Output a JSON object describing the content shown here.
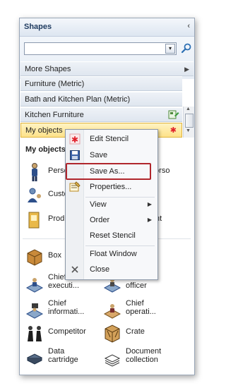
{
  "pane": {
    "title": "Shapes",
    "collapse_glyph": "‹",
    "search_dropdown_glyph": "▾",
    "search_value": "",
    "search_icon": "search-icon"
  },
  "stencils": [
    {
      "label": "More Shapes",
      "has_arrow": true
    },
    {
      "label": "Furniture (Metric)"
    },
    {
      "label": "Bath and Kitchen Plan (Metric)"
    },
    {
      "label": "Kitchen  Furniture"
    },
    {
      "label": "My objects",
      "active": true,
      "marker": "✱"
    }
  ],
  "arrow_glyph": "▶",
  "section_label": "My objects",
  "shapes": [
    {
      "label": "Person",
      "partial": "Perso"
    },
    {
      "label": "torso",
      "partial": "torso"
    },
    {
      "label": "Custo"
    },
    {
      "label": "Produ"
    },
    {
      "label": "nt"
    },
    {
      "label": "Box"
    },
    {
      "label": "Chief finance officer",
      "partial": "officer"
    },
    {
      "label": "Chief executi...",
      "line1": "Chief",
      "line2": "executi..."
    },
    {
      "label": "Chief informati...",
      "line1": "Chief",
      "line2": "informati..."
    },
    {
      "label": "Chief operati...",
      "line1": "Chief",
      "line2": "operati..."
    },
    {
      "label": "Competitor"
    },
    {
      "label": "Crate"
    },
    {
      "label": "Data cartridge",
      "line1": "Data",
      "line2": "cartridge"
    },
    {
      "label": "Document collection",
      "line1": "Document",
      "line2": "collection"
    }
  ],
  "menu": {
    "items": [
      {
        "label": "Edit Stencil",
        "icon": "edit-stencil-icon"
      },
      {
        "label": "Save",
        "icon": "save-icon"
      },
      {
        "label": "Save As...",
        "highlighted": true
      },
      {
        "label": "Properties...",
        "icon": "properties-icon"
      },
      {
        "label": "View",
        "submenu": true
      },
      {
        "label": "Order",
        "submenu": true
      },
      {
        "label": "Reset Stencil"
      },
      {
        "label": "Float Window"
      },
      {
        "label": "Close",
        "icon": "close-icon"
      }
    ]
  },
  "colors": {
    "accent_highlight": "#b0262c",
    "active_bg": "#fde28a",
    "marker_red": "#e0202a"
  }
}
